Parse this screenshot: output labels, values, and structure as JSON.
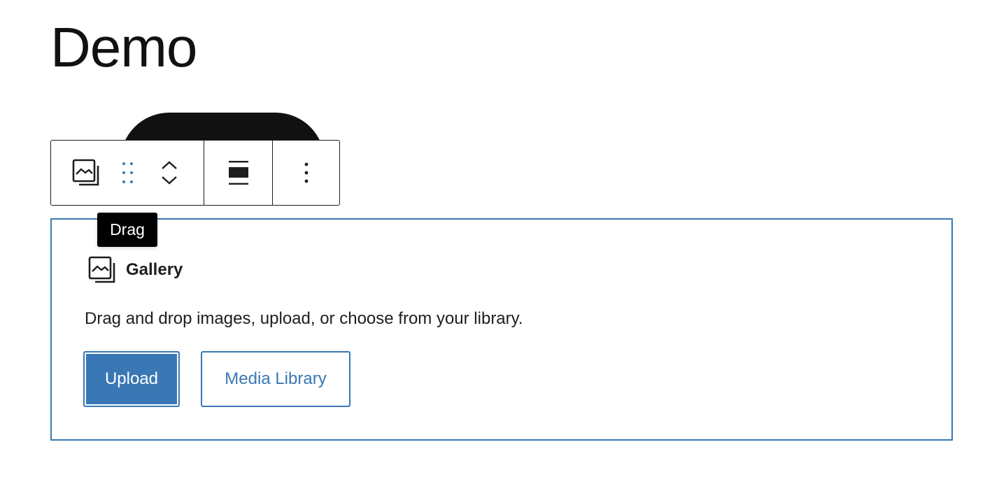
{
  "post": {
    "title": "Demo"
  },
  "toolbar": {
    "block_type_icon": "gallery-icon",
    "drag_icon": "drag-handle-icon",
    "move_up_icon": "chevron-up-icon",
    "move_down_icon": "chevron-down-icon",
    "align_icon": "align-wide-icon",
    "options_icon": "more-vertical-icon"
  },
  "tooltip": {
    "text": "Drag"
  },
  "gallery_placeholder": {
    "icon": "gallery-icon",
    "label": "Gallery",
    "instructions": "Drag and drop images, upload, or choose from your library.",
    "upload_label": "Upload",
    "media_library_label": "Media Library"
  },
  "colors": {
    "accent": "#3a78b5",
    "text": "#1e1e1e",
    "tooltip_bg": "#000000"
  }
}
